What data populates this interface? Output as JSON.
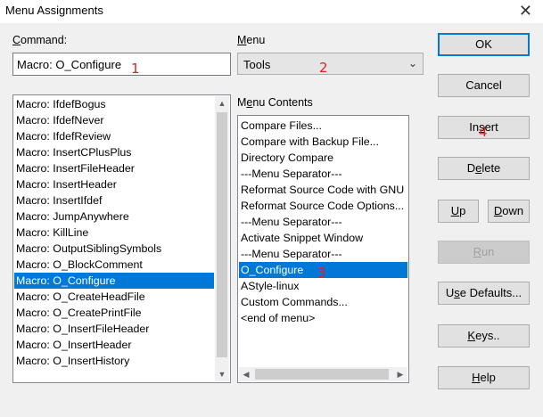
{
  "window": {
    "title": "Menu Assignments",
    "close_glyph": "✕"
  },
  "command": {
    "label_prefix": "C",
    "label_rest": "ommand:",
    "value": "Macro: O_Configure",
    "marker": "1"
  },
  "menu": {
    "label_prefix": "M",
    "label_rest": "enu",
    "selected": "Tools",
    "marker": "2"
  },
  "menu_contents": {
    "label_a": "M",
    "label_u": "e",
    "label_b": "nu Contents",
    "items": [
      "Compare Files...",
      "Compare with Backup File...",
      "Directory Compare",
      "---Menu Separator---",
      "Reformat Source Code with GNU",
      "Reformat Source Code Options...",
      "---Menu Separator---",
      "Activate Snippet Window",
      "---Menu Separator---",
      "O_Configure",
      "AStyle-linux",
      "Custom Commands...",
      "<end of menu>"
    ],
    "selected_index": 9,
    "marker": "3"
  },
  "commands_list": {
    "items": [
      "Macro: IfdefBogus",
      "Macro: IfdefNever",
      "Macro: IfdefReview",
      "Macro: InsertCPlusPlus",
      "Macro: InsertFileHeader",
      "Macro: InsertHeader",
      "Macro: InsertIfdef",
      "Macro: JumpAnywhere",
      "Macro: KillLine",
      "Macro: OutputSiblingSymbols",
      "Macro: O_BlockComment",
      "Macro: O_Configure",
      "Macro: O_CreateHeadFile",
      "Macro: O_CreatePrintFile",
      "Macro: O_InsertFileHeader",
      "Macro: O_InsertHeader",
      "Macro: O_InsertHistory"
    ],
    "selected_index": 11
  },
  "buttons": {
    "ok": "OK",
    "cancel": "Cancel",
    "insert_a": "In",
    "insert_u": "s",
    "insert_b": "ert",
    "insert_marker": "4",
    "delete_a": "D",
    "delete_u": "e",
    "delete_b": "lete",
    "up_u": "U",
    "up_b": "p",
    "down_u": "D",
    "down_b": "own",
    "run_u": "R",
    "run_b": "un",
    "use_defaults_a": "U",
    "use_defaults_u": "s",
    "use_defaults_b": "e Defaults...",
    "keys_u": "K",
    "keys_b": "eys..",
    "help_u": "H",
    "help_b": "elp"
  },
  "colors": {
    "selection": "#0078d7",
    "marker": "#e02020",
    "default_button_border": "#0078d7"
  }
}
